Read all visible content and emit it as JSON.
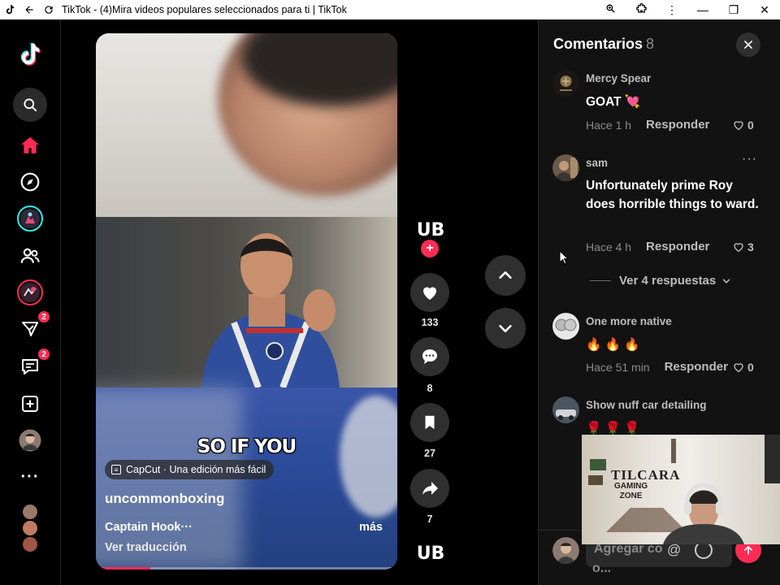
{
  "browser": {
    "title": "TikTok - (4)Mira videos populares seleccionados para ti | TikTok",
    "icons": [
      "tiktok-icon",
      "back-arrow-icon",
      "reload-icon",
      "zoom-icon",
      "extensions-icon",
      "menu-dots-icon",
      "minimize-icon",
      "maximize-icon",
      "close-icon"
    ]
  },
  "sidebar": {
    "badges": {
      "inbox": "2",
      "messages": "2"
    },
    "more": "···"
  },
  "video": {
    "overlay_text": "SO IF YOU",
    "capcut_label": "CapCut · Una edición más fácil",
    "author": "uncommonboxing",
    "caption": "Captain Hook···",
    "more_label": "más",
    "translate_label": "Ver traducción",
    "progress": 0.18
  },
  "actions": {
    "likes": "133",
    "comments": "8",
    "saves": "27",
    "shares": "7"
  },
  "comments_panel": {
    "title": "Comentarios",
    "count": "8",
    "comments": [
      {
        "user": "Mercy Spear",
        "text": "GOAT 💘",
        "time": "Hace 1 h",
        "reply": "Responder",
        "likes": "0"
      },
      {
        "user": "sam",
        "text": "Unfortunately prime Roy does horrible things to ward.",
        "time": "Hace 4 h",
        "reply": "Responder",
        "likes": "3",
        "more": "···"
      },
      {
        "user": "One more native",
        "text": "🔥 🔥 🔥",
        "time": "Hace 51 min",
        "reply": "Responder",
        "likes": "0"
      },
      {
        "user": "Show nuff car detailing",
        "text": "🌹 🌹 🌹"
      }
    ],
    "view_replies": "Ver 4 respuestas",
    "composer_placeholder": "Agregar comentario...",
    "composer_placeholder_line1": "Agregar co",
    "composer_placeholder_line2": "o..."
  },
  "webcam": {
    "title": "TILCARA",
    "subtitle_line1": "GAMING",
    "subtitle_line2": "ZONE"
  },
  "colors": {
    "accent": "#fe2c55",
    "background": "#000000",
    "panel": "#121212",
    "button": "#2f2f2f"
  }
}
